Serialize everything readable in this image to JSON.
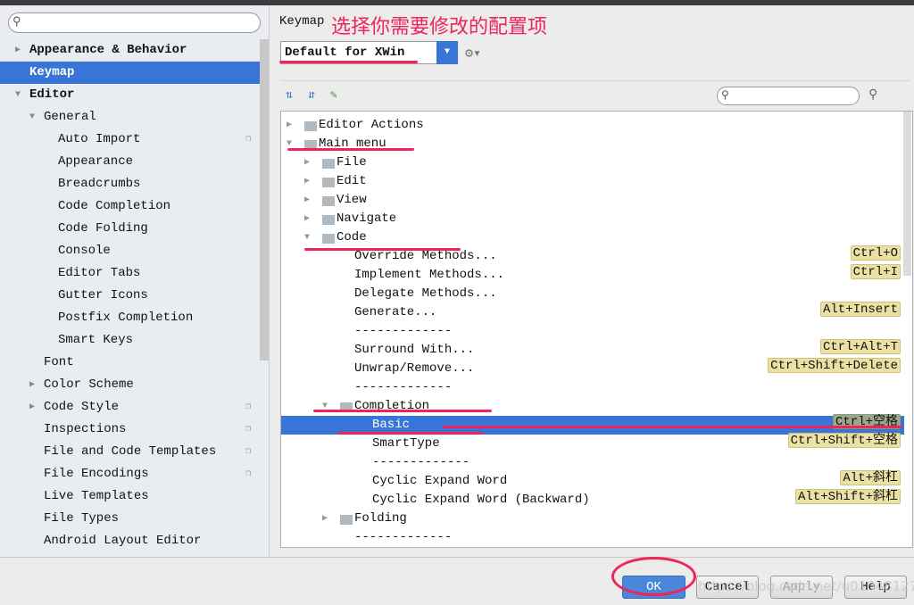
{
  "annotation": "选择你需要修改的配置项",
  "sidebar": {
    "search_placeholder": "",
    "items": [
      {
        "label": "Appearance & Behavior",
        "level": 0,
        "arrow": "right",
        "bold": true
      },
      {
        "label": "Keymap",
        "level": 0,
        "selected": true,
        "bold": true
      },
      {
        "label": "Editor",
        "level": 0,
        "arrow": "down",
        "bold": true
      },
      {
        "label": "General",
        "level": 1,
        "arrow": "down"
      },
      {
        "label": "Auto Import",
        "level": 2,
        "copy": true
      },
      {
        "label": "Appearance",
        "level": 2
      },
      {
        "label": "Breadcrumbs",
        "level": 2
      },
      {
        "label": "Code Completion",
        "level": 2
      },
      {
        "label": "Code Folding",
        "level": 2
      },
      {
        "label": "Console",
        "level": 2
      },
      {
        "label": "Editor Tabs",
        "level": 2
      },
      {
        "label": "Gutter Icons",
        "level": 2
      },
      {
        "label": "Postfix Completion",
        "level": 2
      },
      {
        "label": "Smart Keys",
        "level": 2
      },
      {
        "label": "Font",
        "level": 1
      },
      {
        "label": "Color Scheme",
        "level": 1,
        "arrow": "right"
      },
      {
        "label": "Code Style",
        "level": 1,
        "arrow": "right",
        "copy": true
      },
      {
        "label": "Inspections",
        "level": 1,
        "copy": true
      },
      {
        "label": "File and Code Templates",
        "level": 1,
        "copy": true
      },
      {
        "label": "File Encodings",
        "level": 1,
        "copy": true
      },
      {
        "label": "Live Templates",
        "level": 1
      },
      {
        "label": "File Types",
        "level": 1
      },
      {
        "label": "Android Layout Editor",
        "level": 1
      }
    ]
  },
  "main": {
    "title": "Keymap",
    "keymap_value": "Default for XWin",
    "tree_search_placeholder": "",
    "tree": [
      {
        "label": "Editor Actions",
        "level": 0,
        "arrow": "right",
        "folder": true
      },
      {
        "label": "Main menu",
        "level": 0,
        "arrow": "down",
        "folder": true
      },
      {
        "label": "File",
        "level": 1,
        "arrow": "right",
        "folder": true
      },
      {
        "label": "Edit",
        "level": 1,
        "arrow": "right",
        "folder": true
      },
      {
        "label": "View",
        "level": 1,
        "arrow": "right",
        "folder": true
      },
      {
        "label": "Navigate",
        "level": 1,
        "arrow": "right",
        "folder": true
      },
      {
        "label": "Code",
        "level": 1,
        "arrow": "down",
        "folder": true
      },
      {
        "label": "Override Methods...",
        "level": 2,
        "shortcut": "Ctrl+O"
      },
      {
        "label": "Implement Methods...",
        "level": 2,
        "shortcut": "Ctrl+I"
      },
      {
        "label": "Delegate Methods...",
        "level": 2
      },
      {
        "label": "Generate...",
        "level": 2,
        "shortcut": "Alt+Insert"
      },
      {
        "label": "-------------",
        "level": 2
      },
      {
        "label": "Surround With...",
        "level": 2,
        "shortcut": "Ctrl+Alt+T"
      },
      {
        "label": "Unwrap/Remove...",
        "level": 2,
        "shortcut": "Ctrl+Shift+Delete"
      },
      {
        "label": "-------------",
        "level": 2
      },
      {
        "label": "Completion",
        "level": 2,
        "arrow": "down",
        "folder": true
      },
      {
        "label": "Basic",
        "level": 3,
        "shortcut": "Ctrl+空格",
        "selected": true
      },
      {
        "label": "SmartType",
        "level": 3,
        "shortcut": "Ctrl+Shift+空格"
      },
      {
        "label": "-------------",
        "level": 3
      },
      {
        "label": "Cyclic Expand Word",
        "level": 3,
        "shortcut": "Alt+斜杠"
      },
      {
        "label": "Cyclic Expand Word (Backward)",
        "level": 3,
        "shortcut": "Alt+Shift+斜杠"
      },
      {
        "label": "Folding",
        "level": 2,
        "arrow": "right",
        "folder": true
      },
      {
        "label": "-------------",
        "level": 2
      }
    ]
  },
  "buttons": {
    "ok": "OK",
    "cancel": "Cancel",
    "apply": "Apply",
    "help": "Help"
  },
  "watermark": "https://blog.csdn.net/u010481276",
  "colors": {
    "accent": "#3875d7",
    "annotation": "#f0245a",
    "shortcut_bg": "#ebe1a5"
  }
}
